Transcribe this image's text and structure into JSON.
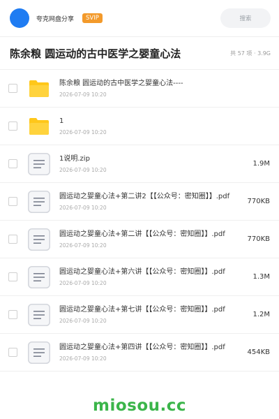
{
  "header": {
    "site_name": "夸克网盘分享",
    "vip_badge": "SVIP",
    "search_placeholder": "搜索",
    "avatar_color": "#1f7cf2"
  },
  "title_bar": {
    "title": "陈余粮 圆运动的古中医学之婴童心法",
    "meta": "共 57 项 · 3.9G"
  },
  "files": [
    {
      "icon": "folder-icon",
      "name": "陈余粮 圆运动的古中医学之婴童心法----",
      "date": "2026-07-09 10:20",
      "size": ""
    },
    {
      "icon": "folder-icon",
      "name": "1",
      "date": "2026-07-09 10:20",
      "size": ""
    },
    {
      "icon": "document-icon",
      "name": "1说明.zip",
      "date": "2026-07-09 10:20",
      "size": "1.9M"
    },
    {
      "icon": "document-icon",
      "name": "圆运动之婴童心法+第二讲2【【公众号：密知圈】】.pdf",
      "date": "2026-07-09 10:20",
      "size": "770KB"
    },
    {
      "icon": "document-icon",
      "name": "圆运动之婴童心法+第二讲【【公众号：密知圈】】.pdf",
      "date": "2026-07-09 10:20",
      "size": "770KB"
    },
    {
      "icon": "document-icon",
      "name": "圆运动之婴童心法+第六讲【【公众号：密知圈】】.pdf",
      "date": "2026-07-09 10:20",
      "size": "1.3M"
    },
    {
      "icon": "document-icon",
      "name": "圆运动之婴童心法+第七讲【【公众号：密知圈】】.pdf",
      "date": "2026-07-09 10:20",
      "size": "1.2M"
    },
    {
      "icon": "document-icon",
      "name": "圆运动之婴童心法+第四讲【【公众号：密知圈】】.pdf",
      "date": "2026-07-09 10:20",
      "size": "454KB"
    }
  ],
  "watermark": "miosou.cc",
  "colors": {
    "folder_yellow": "#ffc71a",
    "vip_orange": "#f39a2b",
    "watermark_green": "#3bb54a"
  }
}
